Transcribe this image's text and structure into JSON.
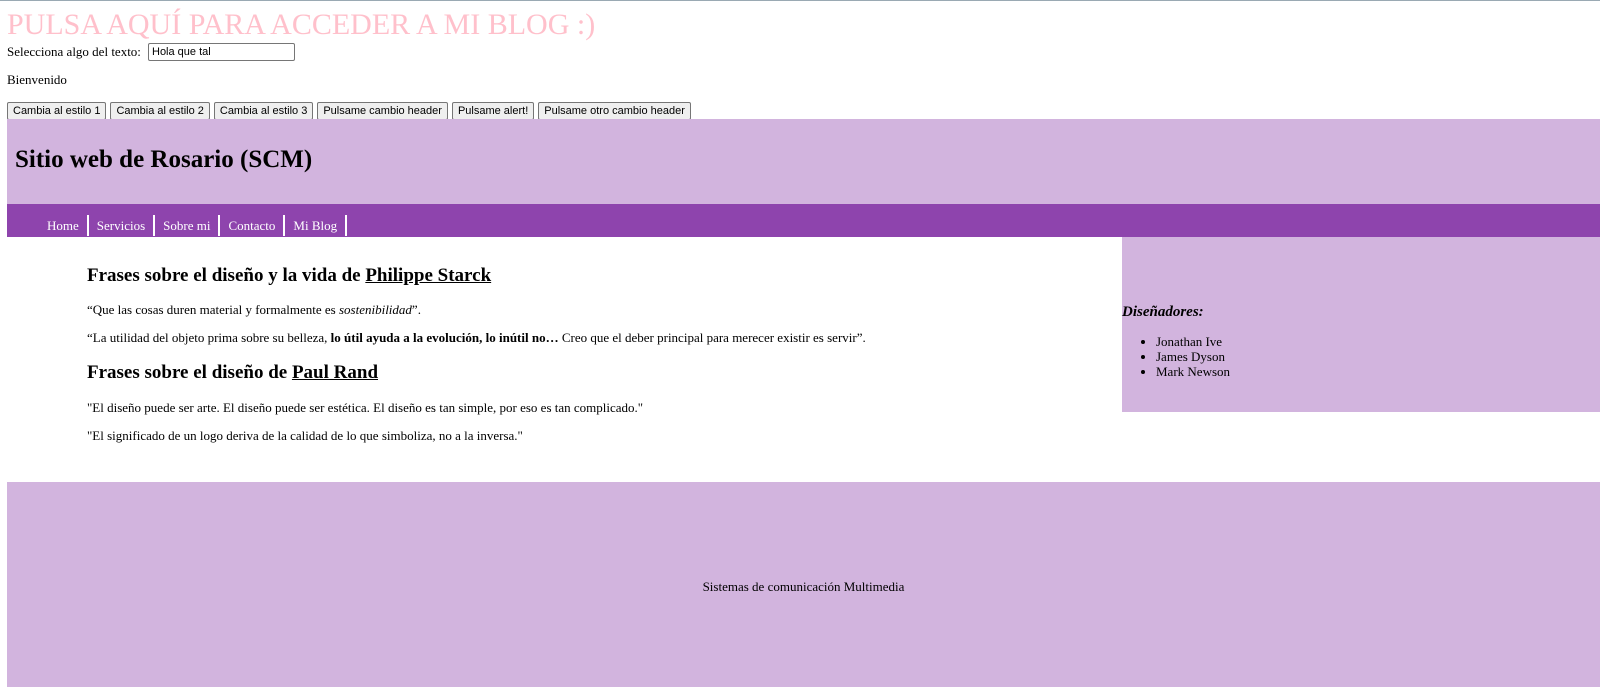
{
  "blog_link": "PULSA AQUÍ PARA ACCEDER A MI BLOG :)",
  "select_row": {
    "label": "Selecciona algo del texto:",
    "input_value": "Hola que tal"
  },
  "welcome": "Bienvenido",
  "buttons": [
    "Cambia al estilo 1",
    "Cambia al estilo 2",
    "Cambia al estilo 3",
    "Pulsame cambio header",
    "Pulsame alert!",
    "Pulsame otro cambio header"
  ],
  "header": {
    "title": "Sitio web de Rosario (SCM)"
  },
  "nav": [
    "Home",
    "Servicios",
    "Sobre mi",
    "Contacto",
    "Mi Blog"
  ],
  "main": {
    "section1": {
      "title_prefix": "Frases sobre el diseño y la vida de ",
      "title_link": "Philippe Starck",
      "quote1": {
        "before": "“Que las cosas duren material y formalmente es ",
        "emphasis": "sostenibilidad",
        "after": "”."
      },
      "quote2": {
        "before": "“La utilidad del objeto prima sobre su belleza, ",
        "strong": "lo útil ayuda a la evolución, lo inútil no…",
        "after": " Creo que el deber principal para merecer existir es servir”."
      }
    },
    "section2": {
      "title_prefix": "Frases sobre el diseño de ",
      "title_link": "Paul Rand",
      "quote1": "\"El diseño puede ser arte. El diseño puede ser estética. El diseño es tan simple, por eso es tan complicado.\"",
      "quote2": "\"El significado de un logo deriva de la calidad de lo que simboliza, no a la inversa.\""
    }
  },
  "aside": {
    "title": "Diseñadores:",
    "items": [
      "Jonathan Ive",
      "James Dyson",
      "Mark Newson"
    ]
  },
  "footer": {
    "text": "Sistemas de comunicación Multimedia"
  },
  "colors": {
    "blog_link": "#ffc0cb",
    "header_bg": "#d2b4de",
    "nav_bg": "#8e44ad"
  }
}
